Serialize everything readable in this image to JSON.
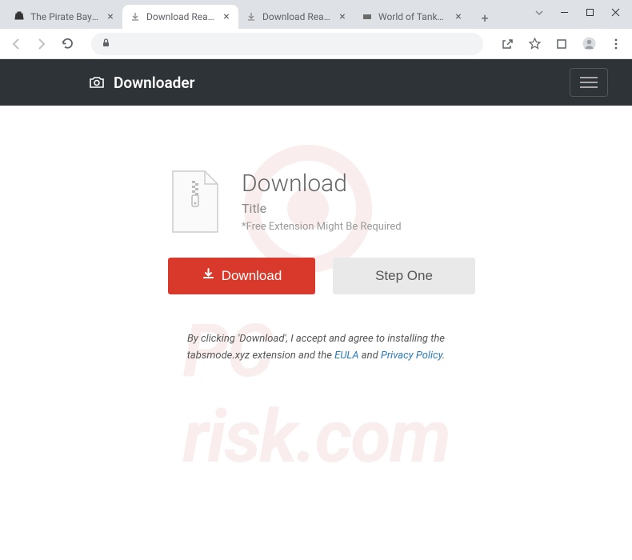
{
  "browser": {
    "tabs": [
      {
        "title": "The Pirate Bay - Th",
        "active": false
      },
      {
        "title": "Download Ready",
        "active": true
      },
      {
        "title": "Download Ready",
        "active": false
      },
      {
        "title": "World of Tanks—F",
        "active": false
      }
    ]
  },
  "page": {
    "brand": "Downloader",
    "heading": "Download",
    "subtitle": "Title",
    "note": "*Free Extension Might Be Required",
    "download_btn": "Download",
    "step_btn": "Step One",
    "legal_pre": "By clicking 'Download', I accept and agree to installing the tabsmode.xyz extension and the ",
    "legal_eula": "EULA",
    "legal_and": " and ",
    "legal_privacy": "Privacy Policy",
    "legal_end": "."
  },
  "watermark": {
    "line1": "PC",
    "line2": "risk.com"
  }
}
